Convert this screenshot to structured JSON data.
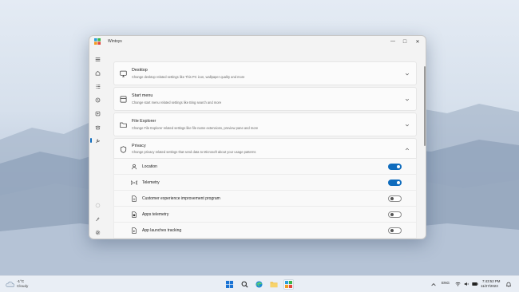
{
  "window": {
    "title": "Wintoys",
    "controls": {
      "minimize": "—",
      "maximize": "□",
      "close": "✕"
    }
  },
  "rail": {
    "items": [
      {
        "icon": "hamburger-menu-icon"
      },
      {
        "icon": "home-icon"
      },
      {
        "icon": "apps-list-icon"
      },
      {
        "icon": "health-icon"
      },
      {
        "icon": "services-icon"
      },
      {
        "icon": "performance-icon"
      },
      {
        "icon": "tweaks-icon",
        "active": true
      },
      {
        "icon": "account-icon"
      },
      {
        "icon": "extensions-icon"
      },
      {
        "icon": "gear-icon"
      }
    ]
  },
  "sections": [
    {
      "title": "Desktop",
      "description": "Change desktop related settings like This PC icon, wallpaper quality and more",
      "expanded": false,
      "icon": "monitor-icon"
    },
    {
      "title": "Start menu",
      "description": "Change start menu related settings like Bing search and more",
      "expanded": false,
      "icon": "start-menu-icon"
    },
    {
      "title": "File Explorer",
      "description": "Change File Explorer related settings like file name extensions, preview pane and more",
      "expanded": false,
      "icon": "folder-icon"
    },
    {
      "title": "Privacy",
      "description": "Change privacy related settings that send data to Microsoft about your usage patterns",
      "expanded": true,
      "icon": "shield-icon"
    }
  ],
  "privacy_items": [
    {
      "label": "Location",
      "enabled": true,
      "icon": "person-pin-icon"
    },
    {
      "label": "Telemetry",
      "enabled": true,
      "icon": "signal-icon"
    },
    {
      "label": "Customer experience improvement program",
      "enabled": false,
      "icon": "document-icon"
    },
    {
      "label": "Apps telemetry",
      "enabled": false,
      "icon": "app-document-icon"
    },
    {
      "label": "App launches tracking",
      "enabled": false,
      "icon": "tracking-icon"
    }
  ],
  "taskbar": {
    "weather": {
      "temp": "-1°C",
      "condition": "Cloudy"
    },
    "apps": [
      "start-icon",
      "search-icon",
      "edge-icon",
      "file-explorer-icon",
      "wintoys-icon"
    ],
    "tray": {
      "language": "ENG",
      "time": "7:43:52 PM",
      "date": "11/27/2023"
    }
  },
  "colors": {
    "accent": "#0f6cbd",
    "window_bg": "#f3f3f3",
    "card_bg": "#fbfbfb"
  }
}
